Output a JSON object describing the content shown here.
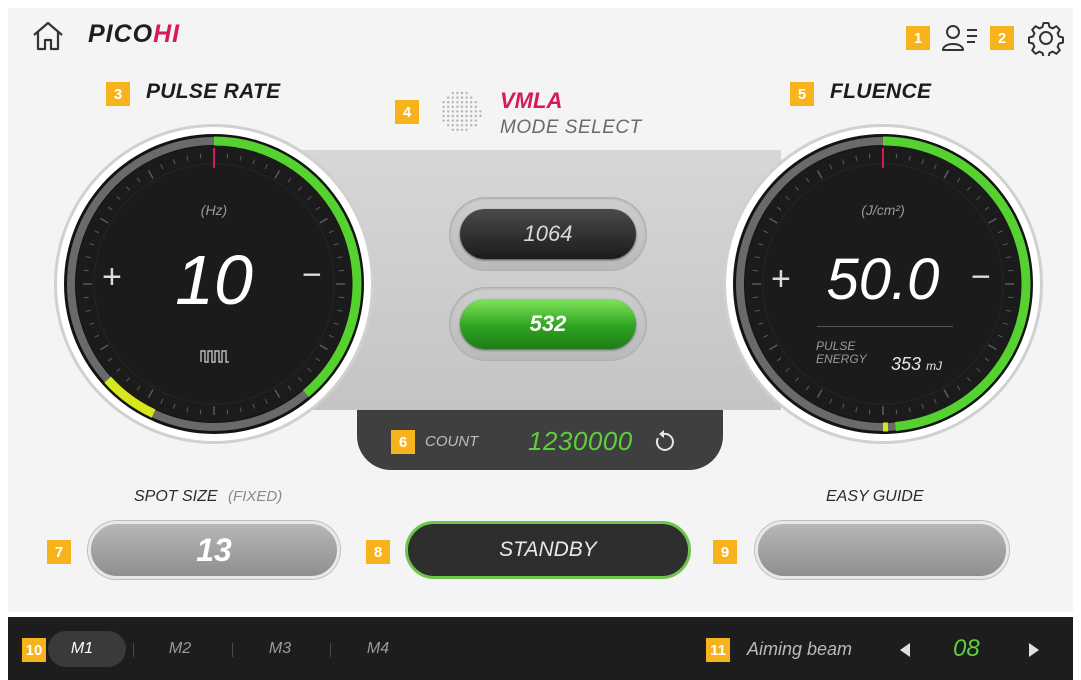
{
  "header": {
    "logo_left": "PICO",
    "logo_right": "HI",
    "home_icon": "home-icon",
    "user_icon": "user-list-icon",
    "settings_icon": "gear-icon"
  },
  "tags": {
    "t1": "1",
    "t2": "2",
    "t3": "3",
    "t4": "4",
    "t5": "5",
    "t6": "6",
    "t7": "7",
    "t8": "8",
    "t9": "9",
    "t10": "10",
    "t11": "11"
  },
  "pulse_rate": {
    "title": "PULSE RATE",
    "unit": "(Hz)",
    "value": "10",
    "plus": "+",
    "minus": "−",
    "icon": "pulse-wave-icon"
  },
  "mode": {
    "name": "VMLA",
    "label": "MODE SELECT",
    "icon": "dot-grid-icon"
  },
  "wavelengths": {
    "w1064": "1064",
    "w532": "532",
    "selected": "532"
  },
  "fluence": {
    "title": "FLUENCE",
    "unit": "(J/cm²)",
    "value": "50.0",
    "plus": "+",
    "minus": "−",
    "pulse_energy_label_1": "PULSE",
    "pulse_energy_label_2": "ENERGY",
    "pulse_energy_value": "353",
    "pulse_energy_unit": "mJ"
  },
  "count": {
    "label": "COUNT",
    "value": "1230000",
    "reset_icon": "reset-icon"
  },
  "spot_size": {
    "label": "SPOT SIZE",
    "note": "(FIXED)",
    "value": "13"
  },
  "standby": {
    "label": "STANDBY"
  },
  "easy_guide": {
    "label": "EASY GUIDE",
    "value": ""
  },
  "memory_tabs": [
    "M1",
    "M2",
    "M3",
    "M4"
  ],
  "aiming_beam": {
    "label": "Aiming beam",
    "value": "08",
    "prev_icon": "caret-left-icon",
    "next_icon": "caret-right-icon"
  },
  "colors": {
    "accent_green": "#5ccf3a",
    "brand_pink": "#d6195a",
    "tag_yellow": "#f7b31c",
    "gauge_yellow": "#d8e61c"
  }
}
